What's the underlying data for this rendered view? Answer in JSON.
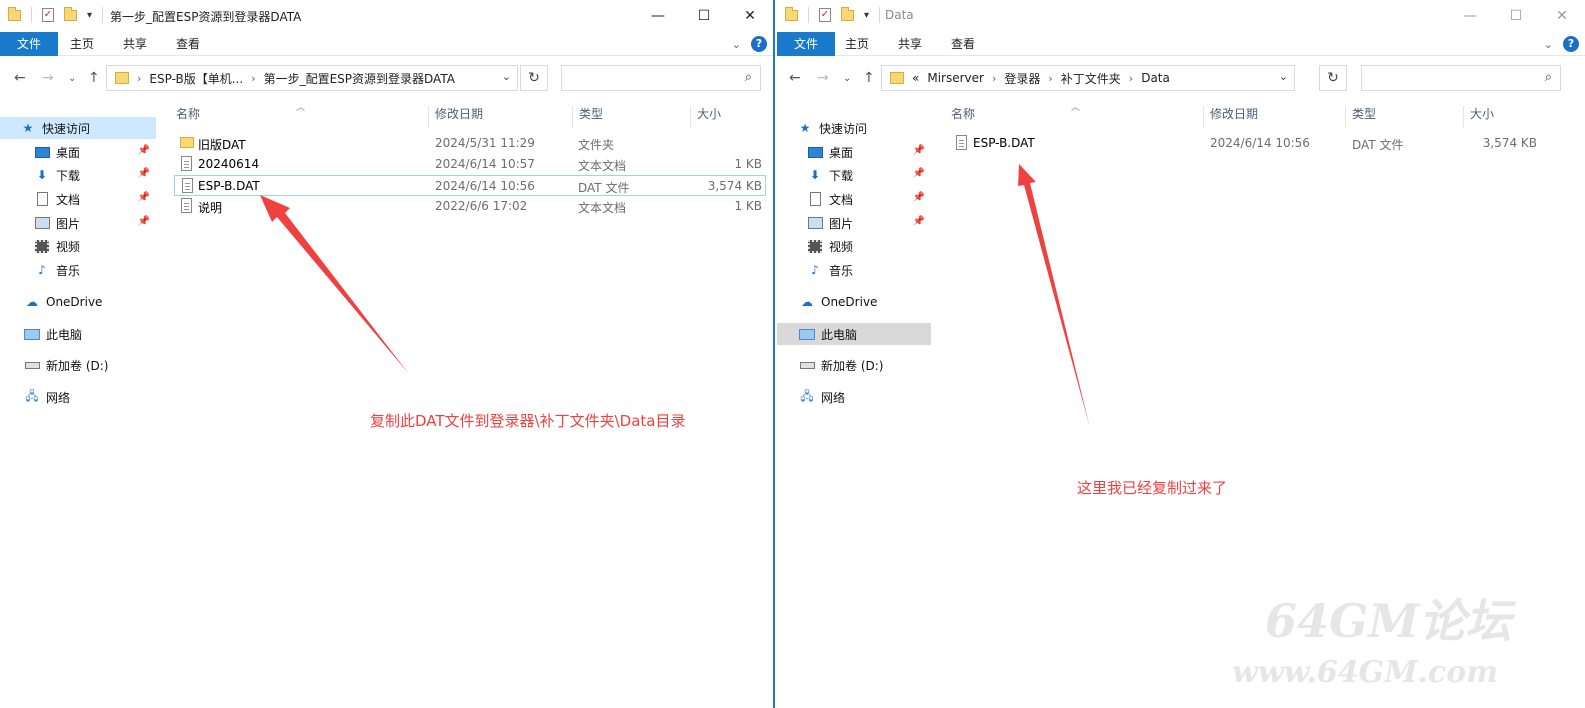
{
  "windows": [
    {
      "title": "第一步_配置ESP资源到登录器DATA",
      "ribbon_tabs": [
        "文件",
        "主页",
        "共享",
        "查看"
      ],
      "breadcrumbs": [
        "ESP-B版【单机...",
        "第一步_配置ESP资源到登录器DATA"
      ],
      "columns": [
        "名称",
        "修改日期",
        "类型",
        "大小"
      ],
      "files": [
        {
          "name": "旧版DAT",
          "date": "2024/5/31 11:29",
          "type": "文件夹",
          "size": "",
          "icon": "folder-icon"
        },
        {
          "name": "20240614",
          "date": "2024/6/14 10:57",
          "type": "文本文档",
          "size": "1 KB",
          "icon": "text-file-icon"
        },
        {
          "name": "ESP-B.DAT",
          "date": "2024/6/14 10:56",
          "type": "DAT 文件",
          "size": "3,574 KB",
          "icon": "file-icon"
        },
        {
          "name": "说明",
          "date": "2022/6/6 17:02",
          "type": "文本文档",
          "size": "1 KB",
          "icon": "text-file-icon"
        }
      ]
    },
    {
      "title": "Data",
      "ribbon_tabs": [
        "文件",
        "主页",
        "共享",
        "查看"
      ],
      "breadcrumb_prefix": "«",
      "breadcrumbs": [
        "Mirserver",
        "登录器",
        "补丁文件夹",
        "Data"
      ],
      "columns": [
        "名称",
        "修改日期",
        "类型",
        "大小"
      ],
      "files": [
        {
          "name": "ESP-B.DAT",
          "date": "2024/6/14 10:56",
          "type": "DAT 文件",
          "size": "3,574 KB",
          "icon": "file-icon"
        }
      ]
    }
  ],
  "sidebar": {
    "quick_access": "快速访问",
    "items": [
      {
        "label": "桌面",
        "icon": "desktop-icon",
        "pinned": true
      },
      {
        "label": "下载",
        "icon": "download-icon",
        "pinned": true
      },
      {
        "label": "文档",
        "icon": "document-icon",
        "pinned": true
      },
      {
        "label": "图片",
        "icon": "pictures-icon",
        "pinned": true
      },
      {
        "label": "视频",
        "icon": "video-icon",
        "pinned": false
      },
      {
        "label": "音乐",
        "icon": "music-icon",
        "pinned": false
      }
    ],
    "onedrive": "OneDrive",
    "this_pc": "此电脑",
    "drive": "新加卷 (D:)",
    "network": "网络"
  },
  "annotations": {
    "left": "复制此DAT文件到登录器\\补丁文件夹\\Data目录",
    "right": "这里我已经复制过来了"
  },
  "watermark": {
    "line1": "64GM论坛",
    "line2": "www.64GM.com"
  },
  "colors": {
    "accent": "#1979ca",
    "annotation": "#f04141",
    "selection": "#cde8ff"
  }
}
